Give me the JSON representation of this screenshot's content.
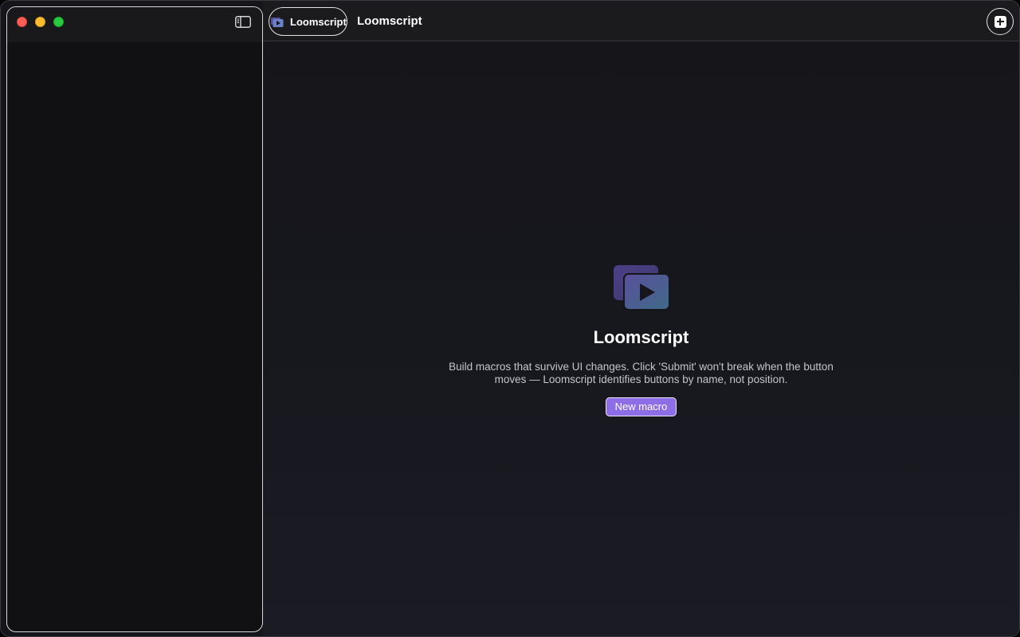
{
  "app": {
    "name": "Loomscript",
    "accent_color": "#8e6ee6"
  },
  "toolbar": {
    "pill_label": "Loomscript",
    "title": "Loomscript",
    "add_icon": "plus-square-icon"
  },
  "sidebar": {
    "toggle_icon": "sidebar-toggle-icon"
  },
  "empty_state": {
    "title": "Loomscript",
    "description": "Build macros that survive UI changes. Click 'Submit' won't break when the button moves — Loomscript identifies buttons by name, not position.",
    "button_label": "New macro",
    "icon": "play-stack-icon"
  }
}
